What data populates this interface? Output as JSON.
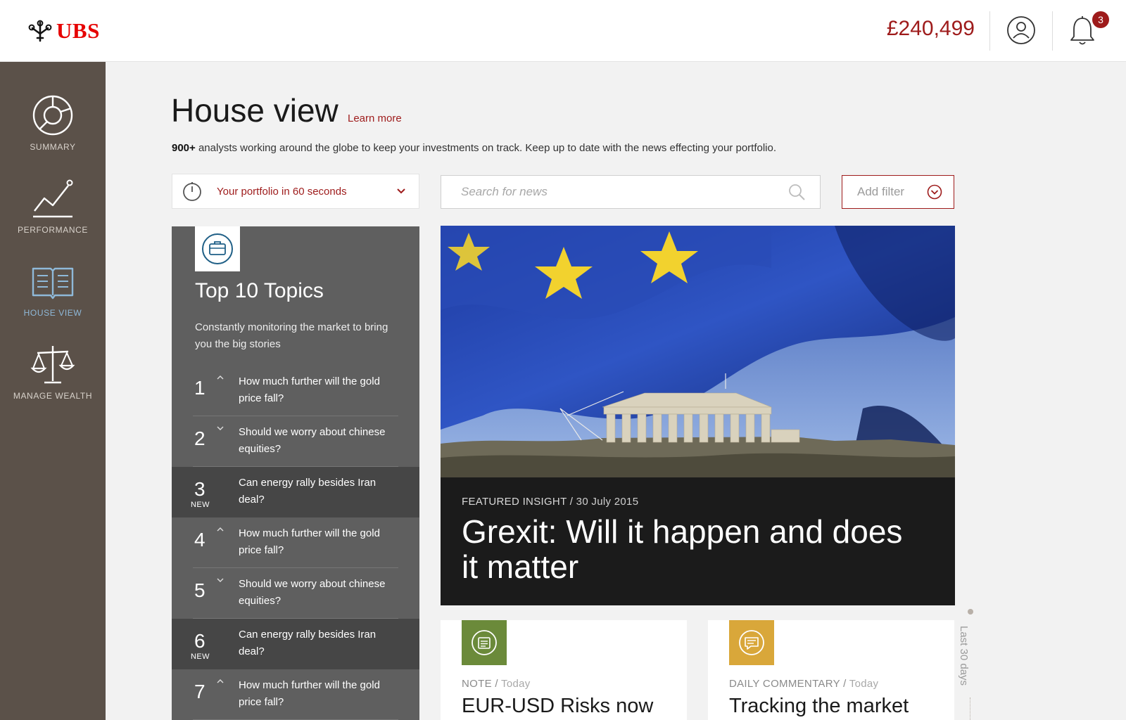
{
  "header": {
    "logo_text": "UBS",
    "balance": "£240,499",
    "notification_count": "3"
  },
  "sidebar": {
    "items": [
      {
        "label": "SUMMARY",
        "icon": "summary-pie-icon"
      },
      {
        "label": "PERFORMANCE",
        "icon": "line-chart-icon"
      },
      {
        "label": "HOUSE VIEW",
        "icon": "open-book-icon",
        "active": true
      },
      {
        "label": "MANAGE WEALTH",
        "icon": "scales-icon"
      }
    ]
  },
  "main": {
    "title": "House view",
    "learn_more": "Learn more",
    "intro_bold": "900+",
    "intro_rest": " analysts working around the globe to keep your investments on track. Keep up to date with the news effecting your portfolio.",
    "portfolio_select": "Your portfolio in 60 seconds",
    "search_placeholder": "Search for news",
    "filter_label": "Add filter"
  },
  "topics": {
    "title": "Top 10 Topics",
    "description": "Constantly monitoring the market to bring you the big stories",
    "items": [
      {
        "num": "1",
        "trend": "up",
        "text": "How much further will the gold price fall?",
        "new": ""
      },
      {
        "num": "2",
        "trend": "down",
        "text": "Should we worry about chinese equities?",
        "new": ""
      },
      {
        "num": "3",
        "trend": "",
        "text": "Can energy rally besides Iran deal?",
        "new": "NEW"
      },
      {
        "num": "4",
        "trend": "up",
        "text": "How much further will the gold price fall?",
        "new": ""
      },
      {
        "num": "5",
        "trend": "down",
        "text": "Should we worry about chinese equities?",
        "new": ""
      },
      {
        "num": "6",
        "trend": "",
        "text": "Can energy rally besides Iran deal?",
        "new": "NEW"
      },
      {
        "num": "7",
        "trend": "up",
        "text": "How much further will the gold price fall?",
        "new": ""
      }
    ]
  },
  "featured": {
    "type": "FEATURED INSIGHT /",
    "date": "30 July 2015",
    "title": "Grexit: Will it happen and does it matter"
  },
  "timeline": {
    "label": "Last 30 days"
  },
  "cards": [
    {
      "type": "NOTE",
      "separator": "/",
      "date": "Today",
      "title": "EUR-USD Risks now",
      "icon": "note-icon",
      "color": "#6b8a3a"
    },
    {
      "type": "DAILY COMMENTARY",
      "separator": "/",
      "date": "Today",
      "title": "Tracking the market",
      "icon": "speech-bubble-icon",
      "color": "#d9a73a"
    }
  ],
  "colors": {
    "brand_red": "#e60000",
    "accent_red": "#9e1b1b",
    "sidebar": "#5b5149",
    "active_nav": "#8fb9d9"
  }
}
